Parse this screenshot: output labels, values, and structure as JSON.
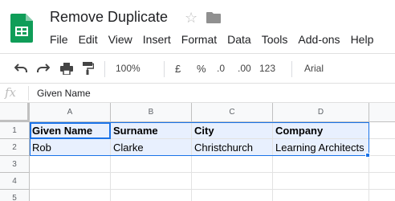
{
  "header": {
    "title": "Remove Duplicate",
    "menu": [
      "File",
      "Edit",
      "View",
      "Insert",
      "Format",
      "Data",
      "Tools",
      "Add-ons",
      "Help"
    ]
  },
  "toolbar": {
    "zoom": "100%",
    "currency": "£",
    "percent": "%",
    "decrease_decimal": ".0",
    "increase_decimal": ".00",
    "more_formats": "123",
    "font": "Arial"
  },
  "formula_bar": {
    "fx": "fx",
    "content": "Given Name"
  },
  "grid": {
    "columns": [
      "A",
      "B",
      "C",
      "D"
    ],
    "rows": [
      "1",
      "2",
      "3",
      "4",
      "5"
    ],
    "cells": [
      [
        "Given Name",
        "Surname",
        "City",
        "Company"
      ],
      [
        "Rob",
        "Clarke",
        "Christchurch",
        "Learning Architects"
      ]
    ]
  },
  "colors": {
    "selection": "#1a73e8",
    "selection_fill": "#e8f0fe",
    "logo_green": "#0f9d58"
  }
}
